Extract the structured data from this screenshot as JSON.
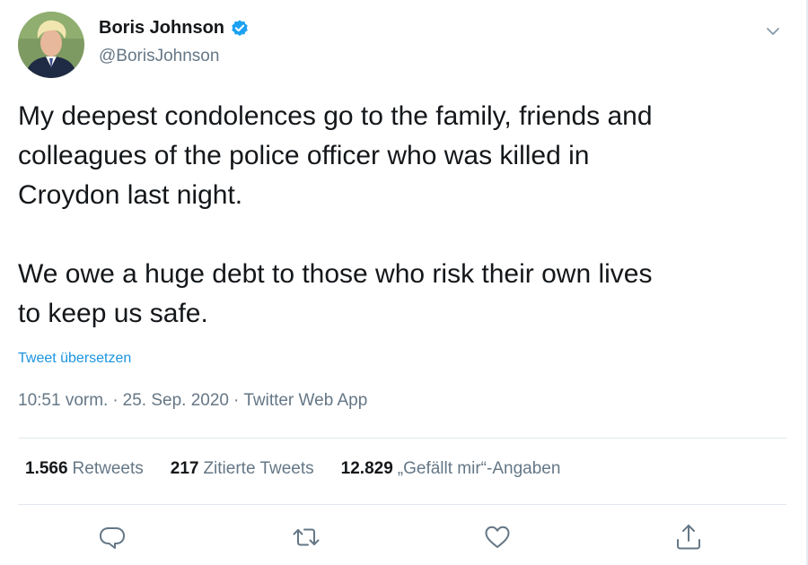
{
  "author": {
    "name": "Boris Johnson",
    "handle": "@BorisJohnson",
    "avatar_icon": "profile-photo",
    "verified_icon": "verified-badge-icon",
    "verified_color": "#1da1f2"
  },
  "tweet": {
    "text": "My deepest condolences go to the family, friends and\ncolleagues of the police officer who was killed in\nCroydon last night.\n\nWe owe a huge debt to those who risk their own lives\nto keep us safe.",
    "translate_label": "Tweet übersetzen",
    "time": "10:51 vorm.",
    "date": "25. Sep. 2020",
    "source": "Twitter Web App",
    "separator": "·"
  },
  "stats": [
    {
      "count": "1.566",
      "label": "Retweets"
    },
    {
      "count": "217",
      "label": "Zitierte Tweets"
    },
    {
      "count": "12.829",
      "label": "„Gefällt mir“-Angaben"
    }
  ],
  "actions": [
    "reply-icon",
    "retweet-icon",
    "like-icon",
    "share-icon"
  ],
  "colors": {
    "link": "#1b95e0",
    "secondary_text": "#657786",
    "primary_text": "#14171a"
  }
}
